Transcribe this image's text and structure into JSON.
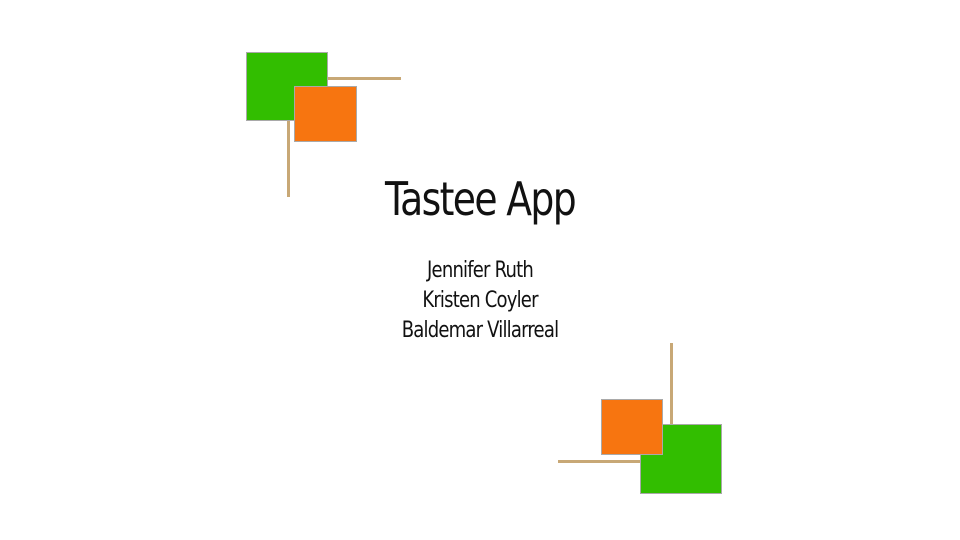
{
  "slide": {
    "title": "Tastee App",
    "authors": [
      "Jennifer Ruth",
      "Kristen Coyler",
      "Baldemar Villarreal"
    ]
  },
  "colors": {
    "green": "#32be00",
    "orange": "#f77510",
    "line": "#c8a876",
    "background": "#ffffff",
    "text": "#111111"
  }
}
